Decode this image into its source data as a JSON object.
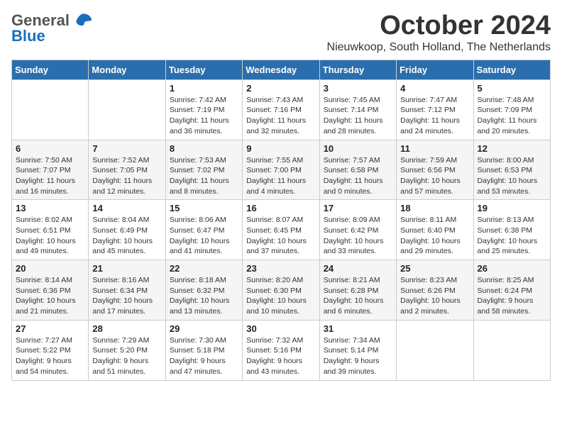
{
  "header": {
    "logo_general": "General",
    "logo_blue": "Blue",
    "month_title": "October 2024",
    "location": "Nieuwkoop, South Holland, The Netherlands"
  },
  "weekdays": [
    "Sunday",
    "Monday",
    "Tuesday",
    "Wednesday",
    "Thursday",
    "Friday",
    "Saturday"
  ],
  "weeks": [
    [
      {
        "day": "",
        "sunrise": "",
        "sunset": "",
        "daylight": ""
      },
      {
        "day": "",
        "sunrise": "",
        "sunset": "",
        "daylight": ""
      },
      {
        "day": "1",
        "sunrise": "Sunrise: 7:42 AM",
        "sunset": "Sunset: 7:19 PM",
        "daylight": "Daylight: 11 hours and 36 minutes."
      },
      {
        "day": "2",
        "sunrise": "Sunrise: 7:43 AM",
        "sunset": "Sunset: 7:16 PM",
        "daylight": "Daylight: 11 hours and 32 minutes."
      },
      {
        "day": "3",
        "sunrise": "Sunrise: 7:45 AM",
        "sunset": "Sunset: 7:14 PM",
        "daylight": "Daylight: 11 hours and 28 minutes."
      },
      {
        "day": "4",
        "sunrise": "Sunrise: 7:47 AM",
        "sunset": "Sunset: 7:12 PM",
        "daylight": "Daylight: 11 hours and 24 minutes."
      },
      {
        "day": "5",
        "sunrise": "Sunrise: 7:48 AM",
        "sunset": "Sunset: 7:09 PM",
        "daylight": "Daylight: 11 hours and 20 minutes."
      }
    ],
    [
      {
        "day": "6",
        "sunrise": "Sunrise: 7:50 AM",
        "sunset": "Sunset: 7:07 PM",
        "daylight": "Daylight: 11 hours and 16 minutes."
      },
      {
        "day": "7",
        "sunrise": "Sunrise: 7:52 AM",
        "sunset": "Sunset: 7:05 PM",
        "daylight": "Daylight: 11 hours and 12 minutes."
      },
      {
        "day": "8",
        "sunrise": "Sunrise: 7:53 AM",
        "sunset": "Sunset: 7:02 PM",
        "daylight": "Daylight: 11 hours and 8 minutes."
      },
      {
        "day": "9",
        "sunrise": "Sunrise: 7:55 AM",
        "sunset": "Sunset: 7:00 PM",
        "daylight": "Daylight: 11 hours and 4 minutes."
      },
      {
        "day": "10",
        "sunrise": "Sunrise: 7:57 AM",
        "sunset": "Sunset: 6:58 PM",
        "daylight": "Daylight: 11 hours and 0 minutes."
      },
      {
        "day": "11",
        "sunrise": "Sunrise: 7:59 AM",
        "sunset": "Sunset: 6:56 PM",
        "daylight": "Daylight: 10 hours and 57 minutes."
      },
      {
        "day": "12",
        "sunrise": "Sunrise: 8:00 AM",
        "sunset": "Sunset: 6:53 PM",
        "daylight": "Daylight: 10 hours and 53 minutes."
      }
    ],
    [
      {
        "day": "13",
        "sunrise": "Sunrise: 8:02 AM",
        "sunset": "Sunset: 6:51 PM",
        "daylight": "Daylight: 10 hours and 49 minutes."
      },
      {
        "day": "14",
        "sunrise": "Sunrise: 8:04 AM",
        "sunset": "Sunset: 6:49 PM",
        "daylight": "Daylight: 10 hours and 45 minutes."
      },
      {
        "day": "15",
        "sunrise": "Sunrise: 8:06 AM",
        "sunset": "Sunset: 6:47 PM",
        "daylight": "Daylight: 10 hours and 41 minutes."
      },
      {
        "day": "16",
        "sunrise": "Sunrise: 8:07 AM",
        "sunset": "Sunset: 6:45 PM",
        "daylight": "Daylight: 10 hours and 37 minutes."
      },
      {
        "day": "17",
        "sunrise": "Sunrise: 8:09 AM",
        "sunset": "Sunset: 6:42 PM",
        "daylight": "Daylight: 10 hours and 33 minutes."
      },
      {
        "day": "18",
        "sunrise": "Sunrise: 8:11 AM",
        "sunset": "Sunset: 6:40 PM",
        "daylight": "Daylight: 10 hours and 29 minutes."
      },
      {
        "day": "19",
        "sunrise": "Sunrise: 8:13 AM",
        "sunset": "Sunset: 6:38 PM",
        "daylight": "Daylight: 10 hours and 25 minutes."
      }
    ],
    [
      {
        "day": "20",
        "sunrise": "Sunrise: 8:14 AM",
        "sunset": "Sunset: 6:36 PM",
        "daylight": "Daylight: 10 hours and 21 minutes."
      },
      {
        "day": "21",
        "sunrise": "Sunrise: 8:16 AM",
        "sunset": "Sunset: 6:34 PM",
        "daylight": "Daylight: 10 hours and 17 minutes."
      },
      {
        "day": "22",
        "sunrise": "Sunrise: 8:18 AM",
        "sunset": "Sunset: 6:32 PM",
        "daylight": "Daylight: 10 hours and 13 minutes."
      },
      {
        "day": "23",
        "sunrise": "Sunrise: 8:20 AM",
        "sunset": "Sunset: 6:30 PM",
        "daylight": "Daylight: 10 hours and 10 minutes."
      },
      {
        "day": "24",
        "sunrise": "Sunrise: 8:21 AM",
        "sunset": "Sunset: 6:28 PM",
        "daylight": "Daylight: 10 hours and 6 minutes."
      },
      {
        "day": "25",
        "sunrise": "Sunrise: 8:23 AM",
        "sunset": "Sunset: 6:26 PM",
        "daylight": "Daylight: 10 hours and 2 minutes."
      },
      {
        "day": "26",
        "sunrise": "Sunrise: 8:25 AM",
        "sunset": "Sunset: 6:24 PM",
        "daylight": "Daylight: 9 hours and 58 minutes."
      }
    ],
    [
      {
        "day": "27",
        "sunrise": "Sunrise: 7:27 AM",
        "sunset": "Sunset: 5:22 PM",
        "daylight": "Daylight: 9 hours and 54 minutes."
      },
      {
        "day": "28",
        "sunrise": "Sunrise: 7:29 AM",
        "sunset": "Sunset: 5:20 PM",
        "daylight": "Daylight: 9 hours and 51 minutes."
      },
      {
        "day": "29",
        "sunrise": "Sunrise: 7:30 AM",
        "sunset": "Sunset: 5:18 PM",
        "daylight": "Daylight: 9 hours and 47 minutes."
      },
      {
        "day": "30",
        "sunrise": "Sunrise: 7:32 AM",
        "sunset": "Sunset: 5:16 PM",
        "daylight": "Daylight: 9 hours and 43 minutes."
      },
      {
        "day": "31",
        "sunrise": "Sunrise: 7:34 AM",
        "sunset": "Sunset: 5:14 PM",
        "daylight": "Daylight: 9 hours and 39 minutes."
      },
      {
        "day": "",
        "sunrise": "",
        "sunset": "",
        "daylight": ""
      },
      {
        "day": "",
        "sunrise": "",
        "sunset": "",
        "daylight": ""
      }
    ]
  ]
}
